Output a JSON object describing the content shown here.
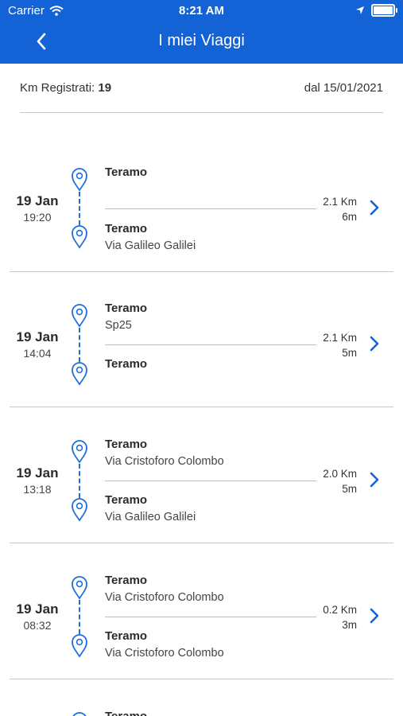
{
  "status_bar": {
    "carrier": "Carrier",
    "time": "8:21 AM"
  },
  "nav": {
    "title": "I miei Viaggi"
  },
  "summary": {
    "km_label": "Km Registrati:",
    "km_value": "19",
    "since": "dal 15/01/2021"
  },
  "trips": [
    {
      "day": "19 Jan",
      "time": "19:20",
      "start_city": "Teramo",
      "start_street": "",
      "end_city": "Teramo",
      "end_street": "Via Galileo Galilei",
      "distance": "2.1 Km",
      "duration": "6m"
    },
    {
      "day": "19 Jan",
      "time": "14:04",
      "start_city": "Teramo",
      "start_street": "Sp25",
      "end_city": "Teramo",
      "end_street": "",
      "distance": "2.1 Km",
      "duration": "5m"
    },
    {
      "day": "19 Jan",
      "time": "13:18",
      "start_city": "Teramo",
      "start_street": "Via Cristoforo Colombo",
      "end_city": "Teramo",
      "end_street": "Via Galileo Galilei",
      "distance": "2.0 Km",
      "duration": "5m"
    },
    {
      "day": "19 Jan",
      "time": "08:32",
      "start_city": "Teramo",
      "start_street": "Via Cristoforo Colombo",
      "end_city": "Teramo",
      "end_street": "Via Cristoforo Colombo",
      "distance": "0.2 Km",
      "duration": "3m"
    },
    {
      "day": "",
      "time": "",
      "start_city": "Teramo",
      "start_street": "",
      "end_city": "",
      "end_street": "",
      "distance": "",
      "duration": ""
    }
  ],
  "colors": {
    "primary": "#1463d6",
    "accent": "#1e6fd9",
    "divider": "#c8c8c8"
  },
  "icons": {
    "back": "chevron-left-icon",
    "pin": "map-pin-icon",
    "chevron": "chevron-right-icon",
    "wifi": "wifi-icon",
    "location": "location-arrow-icon",
    "battery": "battery-icon"
  }
}
